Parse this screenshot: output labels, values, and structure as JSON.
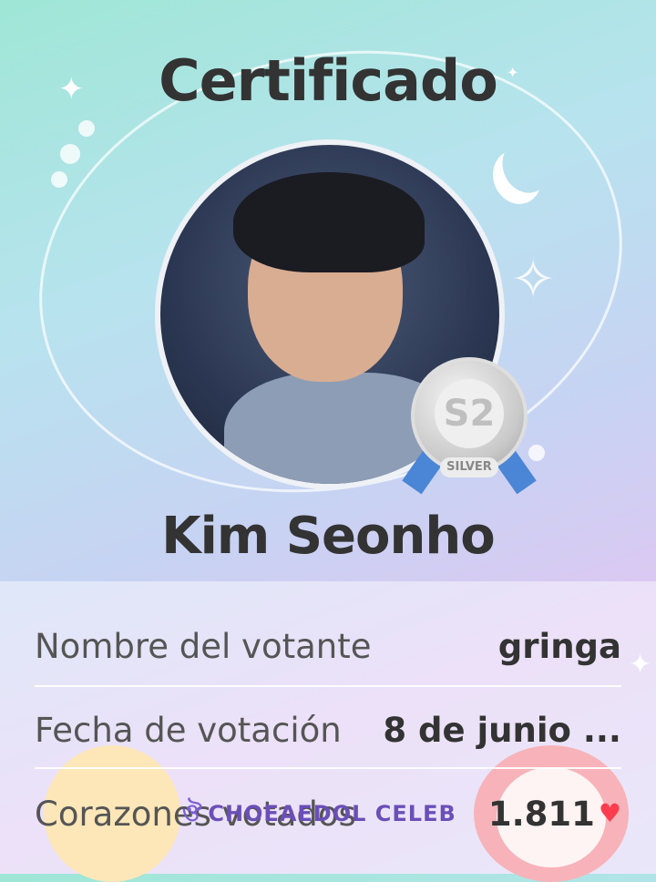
{
  "certificate": {
    "title": "Certificado",
    "celebrity_name": "Kim Seonho",
    "badge_label": "SILVER",
    "badge_mark": "S2"
  },
  "details": [
    {
      "label": "Nombre del votante",
      "value": "gringa"
    },
    {
      "label": "Fecha de votación",
      "value": "8 de junio ..."
    },
    {
      "label": "Corazones votados",
      "value": "1.811"
    }
  ],
  "watermark": {
    "text": "CHOEAEDOL CELEB"
  },
  "colors": {
    "heart": "#ff3d4f",
    "ribbon": "#4b86d6",
    "text": "#333333"
  },
  "icons": [
    "sparkle-icon",
    "moon-icon",
    "silver-medal-icon",
    "heart-icon",
    "choeaedol-logo-icon"
  ]
}
